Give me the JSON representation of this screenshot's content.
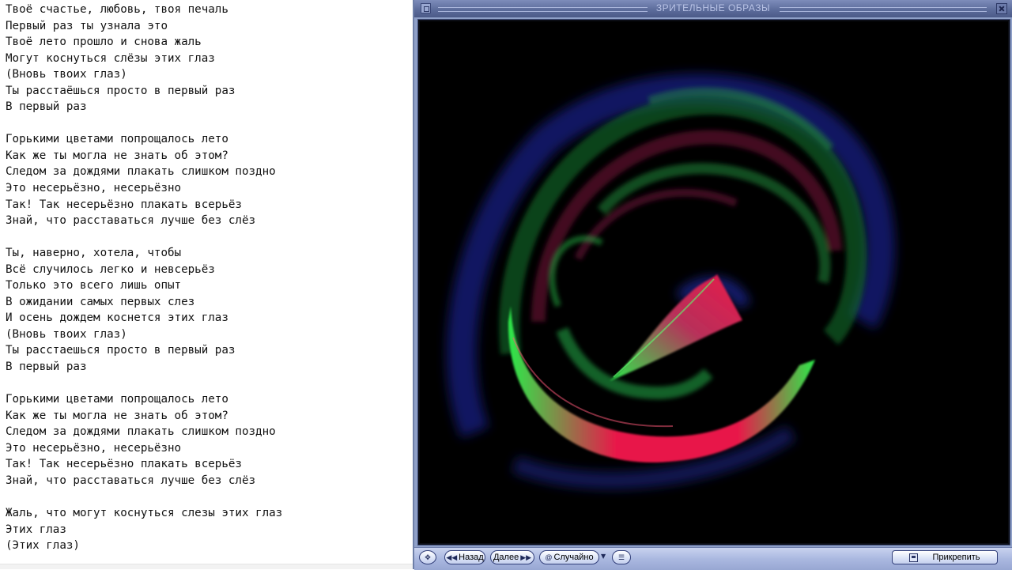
{
  "lyrics": {
    "lines": [
      "Твоё счастье, любовь, твоя печаль",
      "Первый раз ты узнала это",
      "Твоё лето прошло и снова жаль",
      "Могут коснуться слёзы этих глаз",
      "(Вновь твоих глаз)",
      "Ты расстаёшься просто в первый раз",
      "В первый раз",
      "",
      "Горькими цветами попрощалось лето",
      "Как же ты могла не знать об этом?",
      "Следом за дождями плакать слишком поздно",
      "Это несерьёзно, несерьёзно",
      "Так! Так несерьёзно плакать всерьёз",
      "Знай, что расставаться лучше без слёз",
      "",
      "Ты, наверно, хотела, чтобы",
      "Всё случилось легко и невсерьёз",
      "Только это всего лишь опыт",
      "В ожидании самых первых слез",
      "И осень дождем коснется этих глаз",
      "(Вновь твоих глаз)",
      "Ты расстаешься просто в первый раз",
      "В первый раз",
      "",
      "Горькими цветами попрощалось лето",
      "Как же ты могла не знать об этом?",
      "Следом за дождями плакать слишком поздно",
      "Это несерьёзно, несерьёзно",
      "Так! Так несерьёзно плакать всерьёз",
      "Знай, что расставаться лучше без слёз",
      "",
      "Жаль, что могут коснуться слезы этих глаз",
      "Этих глаз",
      "(Этих глаз)"
    ]
  },
  "visualizer": {
    "title": "ЗРИТЕЛЬНЫЕ ОБРАЗЫ",
    "controls": {
      "back_label": "Назад",
      "next_label": "Далее",
      "random_label": "Случайно",
      "attach_label": "Прикрепить"
    },
    "icons": {
      "move": "move-arrows-icon",
      "back": "double-left-triangle-icon",
      "next": "double-right-triangle-icon",
      "random": "random-at-icon",
      "menu": "list-menu-icon",
      "attach": "pin-icon",
      "close": "close-icon",
      "system": "window-system-icon"
    },
    "colors": {
      "window_frame": "#8fa0c8",
      "titlebar": "#5d6d9c",
      "background": "#000000",
      "ribbon_red": "#e8194a",
      "ribbon_green": "#2bea4a",
      "ribbon_blue": "#141e7a"
    }
  }
}
